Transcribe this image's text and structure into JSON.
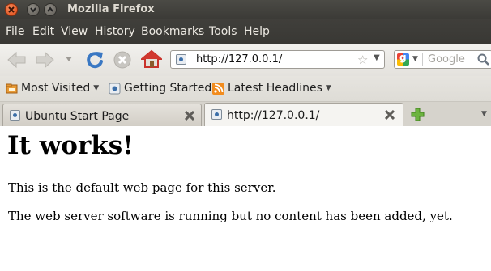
{
  "window": {
    "title": "Mozilla Firefox"
  },
  "menubar": {
    "items": [
      {
        "label": "File",
        "mnemonic": "F"
      },
      {
        "label": "Edit",
        "mnemonic": "E"
      },
      {
        "label": "View",
        "mnemonic": "V"
      },
      {
        "label": "History",
        "mnemonic": "s"
      },
      {
        "label": "Bookmarks",
        "mnemonic": "B"
      },
      {
        "label": "Tools",
        "mnemonic": "T"
      },
      {
        "label": "Help",
        "mnemonic": "H"
      }
    ]
  },
  "navbar": {
    "url": "http://127.0.0.1/",
    "search_placeholder": "Google"
  },
  "bookmarks": {
    "items": [
      {
        "label": "Most Visited",
        "has_menu": true
      },
      {
        "label": "Getting Started",
        "has_menu": false
      },
      {
        "label": "Latest Headlines",
        "has_menu": true
      }
    ]
  },
  "tabs": [
    {
      "label": "Ubuntu Start Page",
      "active": false
    },
    {
      "label": "http://127.0.0.1/",
      "active": true
    }
  ],
  "page": {
    "heading": "It works!",
    "paragraphs": [
      "This is the default web page for this server.",
      "The web server software is running but no content has been added, yet."
    ]
  },
  "colors": {
    "titlebar_bg": "#3c3b37",
    "close_button": "#dd4814",
    "reload_blue": "#3a78c3",
    "home_red": "#c9322a",
    "newtab_green": "#5aa632",
    "rss_orange": "#f28c1e"
  }
}
